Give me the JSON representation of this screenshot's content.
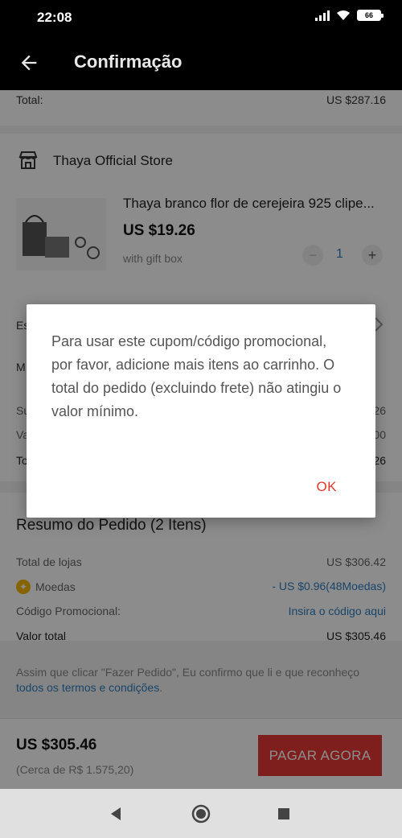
{
  "status": {
    "time": "22:08",
    "battery": "66"
  },
  "appbar": {
    "title": "Confirmação"
  },
  "summary_top": {
    "total_label": "Total:",
    "total_value": "US $287.16"
  },
  "store": {
    "name": "Thaya Official Store",
    "product": {
      "title": "Thaya branco flor de cerejeira 925 clipe...",
      "price": "US $19.26",
      "variant": "with gift box",
      "quantity": "1",
      "minus": "−",
      "plus": "+"
    }
  },
  "partial_rows": {
    "left": [
      "Es",
      "M",
      "Su",
      "Va",
      "To"
    ],
    "right": [
      "26",
      "00",
      "26"
    ]
  },
  "order_summary": {
    "title": "Resumo do Pedido (2 Itens)",
    "stores_total_label": "Total de lojas",
    "stores_total_value": "US $306.42",
    "coins_label": "Moedas",
    "coins_value": "- US $0.96(48Moedas)",
    "promo_label": "Código Promocional:",
    "promo_value": "Insira o código aqui",
    "total_label": "Valor total",
    "total_value": "US $305.46"
  },
  "terms": {
    "text": "Assim que clicar \"Fazer Pedido\", Eu confirmo que li e que reconheço ",
    "link": "todos os termos e condições",
    "end": "."
  },
  "bottom": {
    "total": "US $305.46",
    "approx": "(Cerca de R$ 1.575,20)",
    "pay_button": "PAGAR AGORA"
  },
  "dialog": {
    "message": "Para usar este cupom/código promocional, por favor, adicione mais itens ao carrinho. O total do pedido (excluindo frete) não atingiu o valor mínimo.",
    "ok": "OK"
  },
  "colors": {
    "accent_red": "#e0392b",
    "link_blue": "#2f7fc1",
    "pay_button_bg": "#e53935"
  },
  "icons": [
    "back-arrow-icon",
    "signal-icon",
    "wifi-icon",
    "battery-icon",
    "store-icon",
    "coin-icon",
    "chevron-right-icon",
    "nav-back-icon",
    "nav-home-icon",
    "nav-recents-icon"
  ]
}
